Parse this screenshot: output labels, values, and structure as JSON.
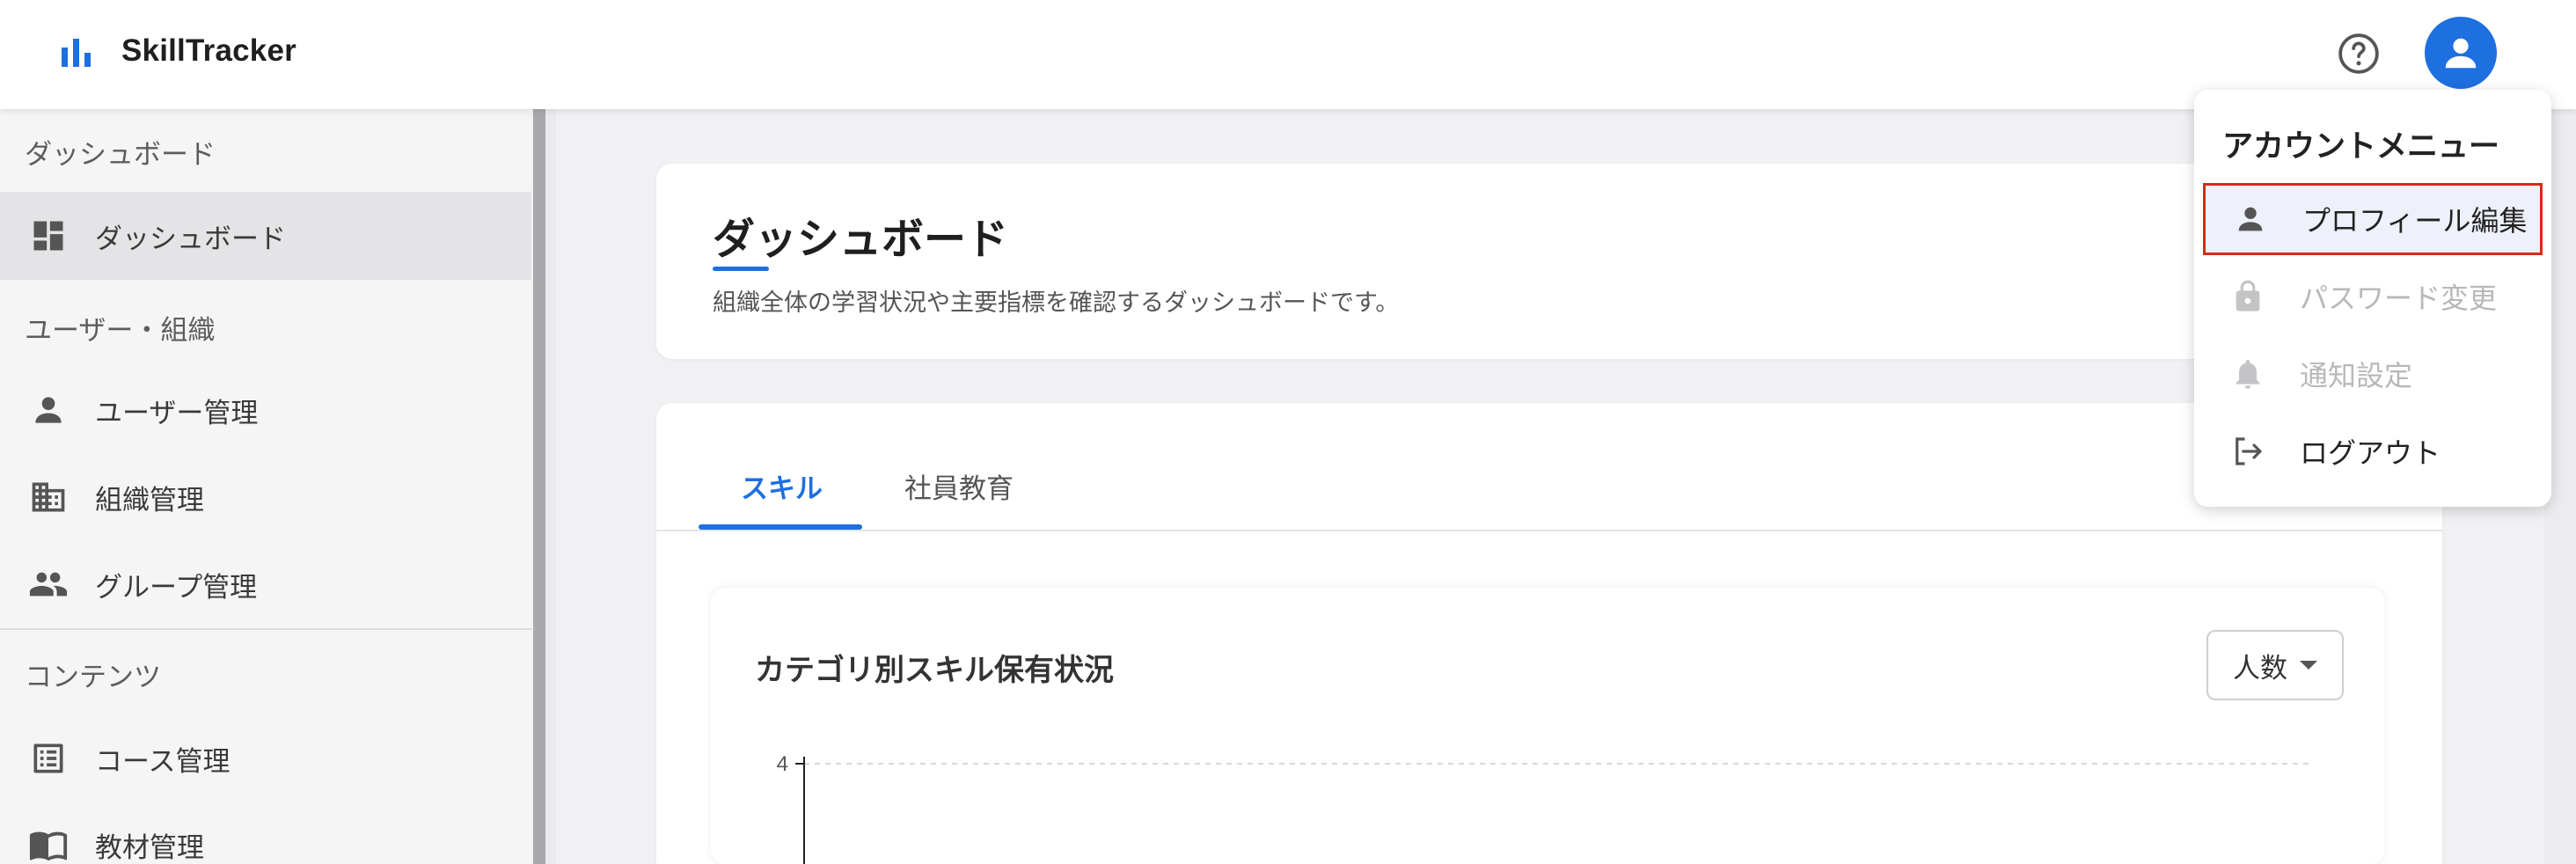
{
  "header": {
    "app_title": "SkillTracker",
    "help_icon": "help-circle-icon",
    "avatar_icon": "person-icon"
  },
  "sidebar": {
    "sections": [
      {
        "label": "ダッシュボード"
      },
      {
        "label": "ユーザー・組織"
      },
      {
        "label": "コンテンツ"
      }
    ],
    "items": [
      {
        "label": "ダッシュボード",
        "icon": "dashboard-icon",
        "active": true
      },
      {
        "label": "ユーザー管理",
        "icon": "person-icon"
      },
      {
        "label": "組織管理",
        "icon": "building-icon"
      },
      {
        "label": "グループ管理",
        "icon": "group-icon"
      },
      {
        "label": "コース管理",
        "icon": "list-icon"
      },
      {
        "label": "教材管理",
        "icon": "book-icon"
      }
    ]
  },
  "main": {
    "page_title": "ダッシュボード",
    "page_description": "組織全体の学習状況や主要指標を確認するダッシュボードです。",
    "tabs": [
      {
        "label": "スキル",
        "active": true
      },
      {
        "label": "社員教育"
      }
    ],
    "chart_card": {
      "title": "カテゴリ別スキル保有状況",
      "dropdown_value": "人数"
    }
  },
  "chart_data": {
    "type": "bar",
    "title": "カテゴリ別スキル保有状況",
    "y_ticks": [
      "4"
    ],
    "grid": true
  },
  "account_menu": {
    "title": "アカウントメニュー",
    "items": [
      {
        "label": "プロフィール編集",
        "icon": "person-icon",
        "highlighted": true
      },
      {
        "label": "パスワード変更",
        "icon": "lock-icon",
        "disabled": true
      },
      {
        "label": "通知設定",
        "icon": "bell-icon",
        "disabled": true
      },
      {
        "label": "ログアウト",
        "icon": "logout-icon"
      }
    ]
  },
  "colors": {
    "accent": "#1e6fe0",
    "highlight_border": "#e0261b"
  }
}
